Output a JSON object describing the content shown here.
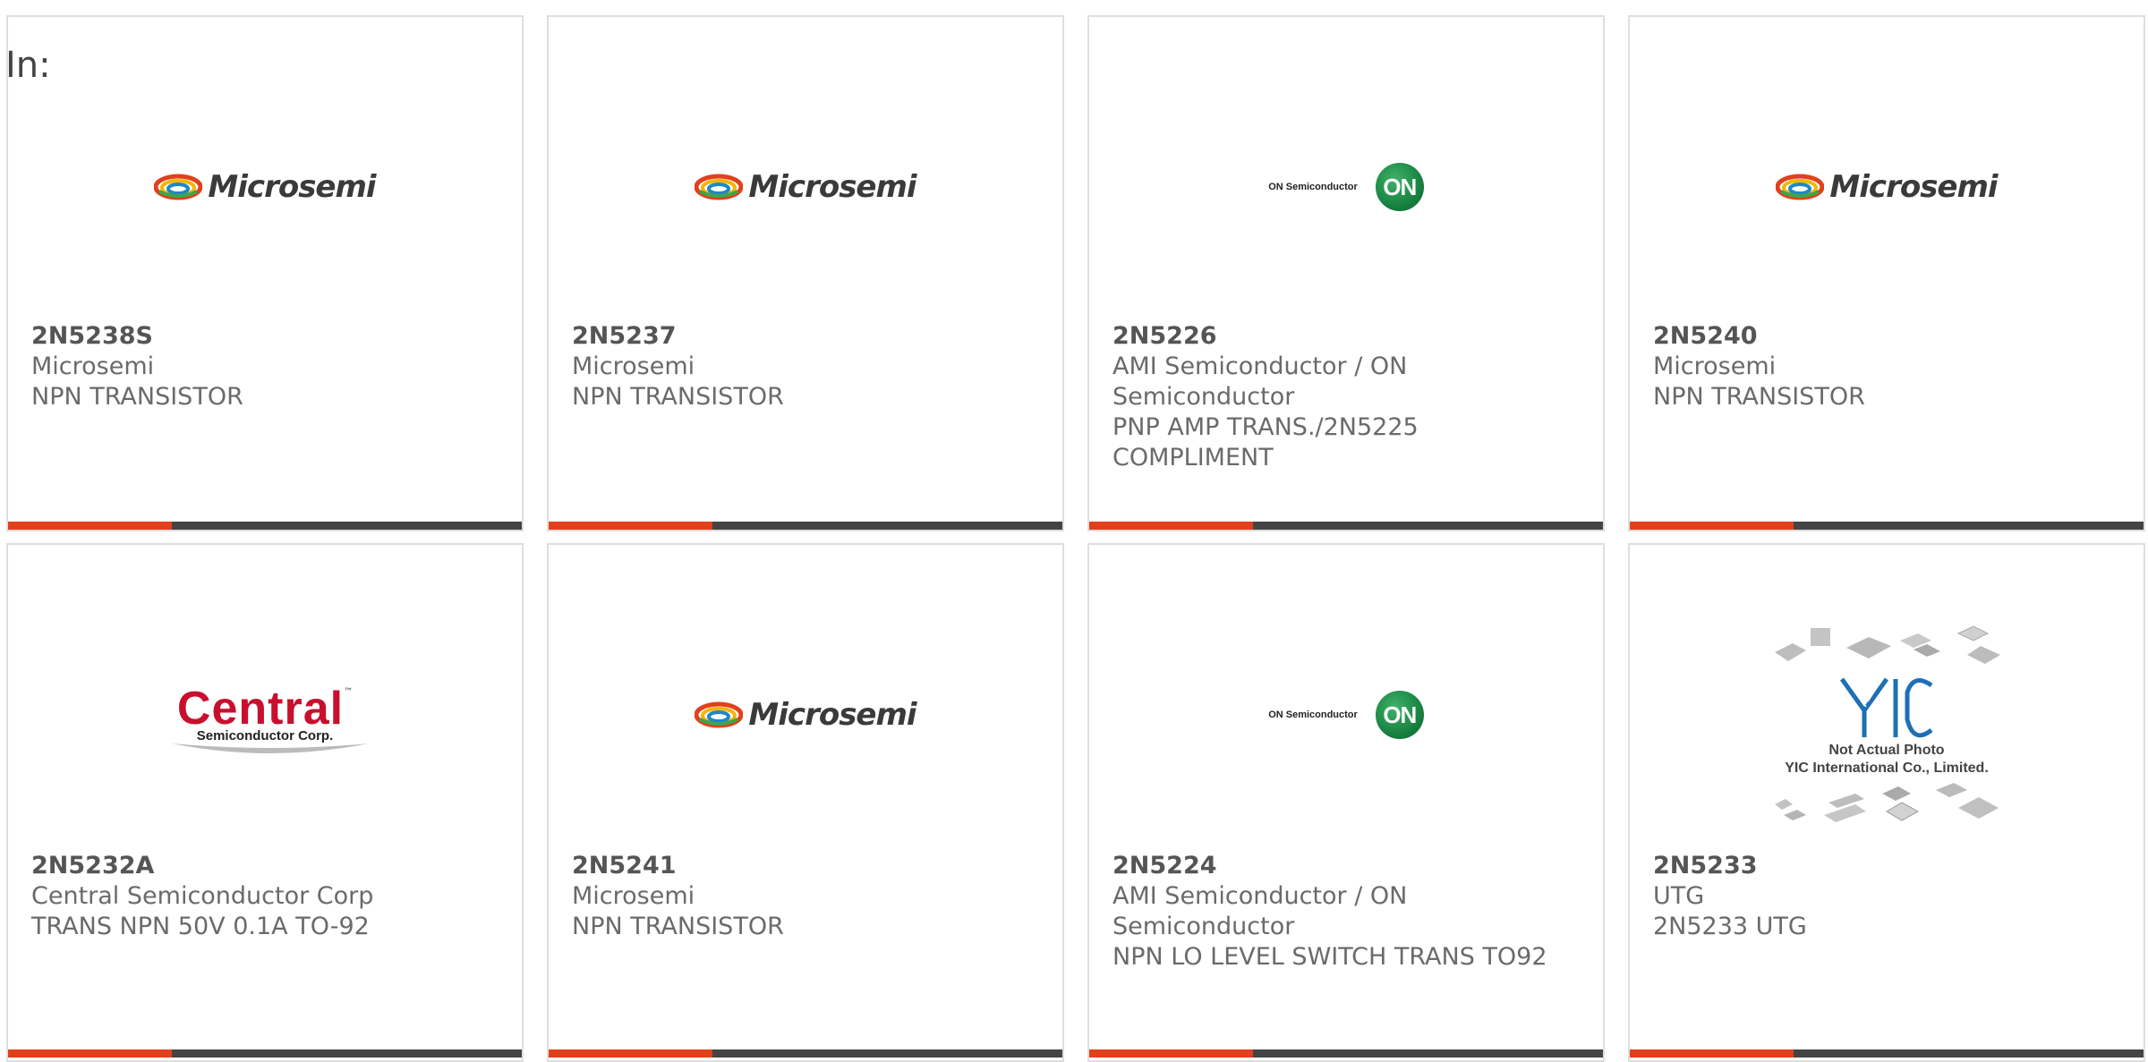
{
  "page": {
    "in_label": "In:"
  },
  "colors": {
    "accent": "#e2401b",
    "bar": "#444444",
    "border": "#dedede",
    "text": "#666666"
  },
  "logos": {
    "microsemi": "Microsemi",
    "on_semi_text": "ON Semiconductor",
    "on_badge": "ON",
    "central_main": "Central",
    "central_sub": "Semiconductor Corp.",
    "central_tm": "™",
    "yic_line1": "Not Actual Photo",
    "yic_line2": "YIC International Co., Limited."
  },
  "products": [
    {
      "part": "2N5238S",
      "manufacturer": "Microsemi",
      "description": "NPN TRANSISTOR",
      "logo": "microsemi"
    },
    {
      "part": "2N5237",
      "manufacturer": "Microsemi",
      "description": "NPN TRANSISTOR",
      "logo": "microsemi"
    },
    {
      "part": "2N5226",
      "manufacturer": "AMI Semiconductor / ON Semiconductor",
      "description": "PNP AMP TRANS./2N5225 COMPLIMENT",
      "logo": "on-semi"
    },
    {
      "part": "2N5240",
      "manufacturer": "Microsemi",
      "description": "NPN TRANSISTOR",
      "logo": "microsemi"
    },
    {
      "part": "2N5232A",
      "manufacturer": "Central Semiconductor Corp",
      "description": "TRANS NPN 50V 0.1A TO-92",
      "logo": "central"
    },
    {
      "part": "2N5241",
      "manufacturer": "Microsemi",
      "description": "NPN TRANSISTOR",
      "logo": "microsemi"
    },
    {
      "part": "2N5224",
      "manufacturer": "AMI Semiconductor / ON Semiconductor",
      "description": "NPN LO LEVEL SWITCH TRANS TO92",
      "logo": "on-semi"
    },
    {
      "part": "2N5233",
      "manufacturer": "UTG",
      "description": "2N5233 UTG",
      "logo": "yic"
    }
  ]
}
